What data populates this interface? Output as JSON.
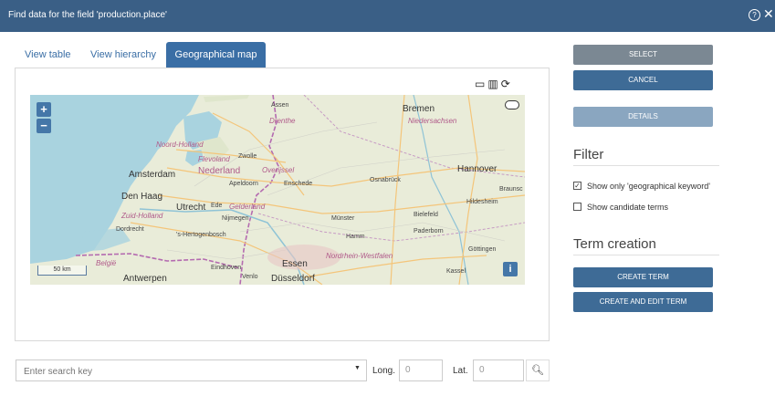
{
  "window": {
    "title": "Find data for the field 'production.place'",
    "help_glyph": "?",
    "close_glyph": "✕"
  },
  "tabs": [
    {
      "label": "View table"
    },
    {
      "label": "View hierarchy"
    },
    {
      "label": "Geographical map",
      "active": true
    }
  ],
  "map": {
    "tool_icons": [
      "layers-icon",
      "map-icon",
      "refresh-icon"
    ],
    "zoom_in": "+",
    "zoom_out": "−",
    "info": "i",
    "scale": "50 km",
    "labels": {
      "assen": "Assen",
      "bremen": "Bremen",
      "drenthe": "Drenthe",
      "niedersachsen": "Niedersachsen",
      "noord_holland": "Noord-Holland",
      "flevoland": "Flevoland",
      "zwolle": "Zwolle",
      "amsterdam": "Amsterdam",
      "nederland": "Nederland",
      "overijssel": "Overijssel",
      "hannover": "Hannover",
      "apeldoorn": "Apeldoorn",
      "enschede": "Enschede",
      "osnabruck": "Osnabrück",
      "braunschweig": "Braunsc",
      "den_haag": "Den Haag",
      "utrecht": "Utrecht",
      "ede": "Ede",
      "gelderland": "Gelderland",
      "hildesheim": "Hildesheim",
      "zuid_holland": "Zuid-Holland",
      "bielefeld": "Bielefeld",
      "nijmegen": "Nijmegen",
      "munster": "Münster",
      "dordrecht": "Dordrecht",
      "hertogenbosch": "'s-Hertogenbosch",
      "paderborn": "Paderborn",
      "hamm": "Hamm",
      "gottingen": "Göttingen",
      "eindhoven": "Eindhoven",
      "essen": "Essen",
      "nordrhein": "Nordrhein-Westfalen",
      "kassel": "Kassel",
      "antwerpen": "Antwerpen",
      "venlo": "Venlo",
      "dusseldorf": "Düsseldorf",
      "belgie": "België"
    },
    "colors": {
      "water": "#a9d3df",
      "land": "#e9ecd9",
      "border": "#b46bb0",
      "road": "#f4c57a"
    }
  },
  "search": {
    "placeholder": "Enter search key",
    "long_label": "Long.",
    "long_value": "0",
    "lat_label": "Lat.",
    "lat_value": "0",
    "search_icon": "search-icon"
  },
  "actions": {
    "select": "SELECT",
    "cancel": "CANCEL",
    "details": "DETAILS"
  },
  "filter": {
    "heading": "Filter",
    "options": [
      {
        "label": "Show only 'geographical keyword'",
        "checked": true
      },
      {
        "label": "Show candidate terms",
        "checked": false
      }
    ]
  },
  "term_creation": {
    "heading": "Term creation",
    "create": "CREATE TERM",
    "create_edit": "CREATE AND EDIT TERM"
  }
}
